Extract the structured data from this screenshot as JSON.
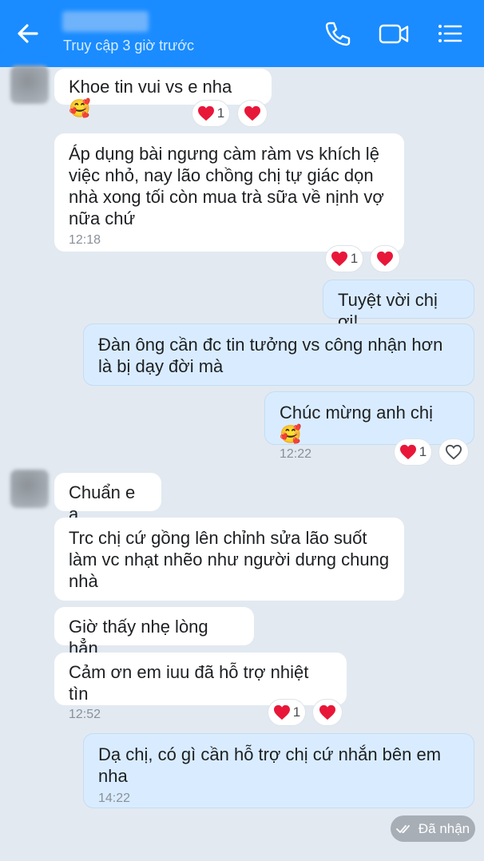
{
  "header": {
    "last_seen": "Truy cập 3 giờ trước",
    "icons": [
      "back-arrow-icon",
      "phone-icon",
      "video-call-icon",
      "menu-list-icon"
    ]
  },
  "messages": [
    {
      "side": "in",
      "text": "Khoe tin vui vs e nha 🥰",
      "reaction_count": "1"
    },
    {
      "side": "in",
      "text": "Áp dụng bài ngưng càm ràm vs khích lệ việc nhỏ, nay lão chồng chị tự giác dọn nhà xong tối còn mua trà sữa về nịnh vợ nữa chứ",
      "time": "12:18",
      "reaction_count": "1"
    },
    {
      "side": "out",
      "text": "Tuyệt vời chị ơi!"
    },
    {
      "side": "out",
      "text": "Đàn ông cần đc tin tưởng vs công nhận hơn là bị dạy đời mà"
    },
    {
      "side": "out",
      "text": "Chúc mừng anh chị 🥰",
      "time": "12:22",
      "reaction_count": "1"
    },
    {
      "side": "in",
      "text": "Chuẩn e ạ"
    },
    {
      "side": "in",
      "text": "Trc chị cứ gồng lên chỉnh sửa lão suốt làm vc nhạt nhẽo như người dưng chung nhà"
    },
    {
      "side": "in",
      "text": "Giờ thấy nhẹ lòng hẳn"
    },
    {
      "side": "in",
      "text": "Cảm ơn em iuu đã hỗ trợ nhiệt tìn",
      "time": "12:52",
      "reaction_count": "1"
    },
    {
      "side": "out",
      "text": "Dạ chị, có gì cần hỗ trợ chị cứ nhắn bên em nha",
      "time": "14:22"
    }
  ],
  "status": {
    "delivered_label": "Đã nhận"
  },
  "colors": {
    "header": "#1a8cff",
    "background": "#e2e9f1",
    "outgoing_bubble": "#d9ecff",
    "incoming_bubble": "#ffffff",
    "heart": "#e8173a"
  }
}
